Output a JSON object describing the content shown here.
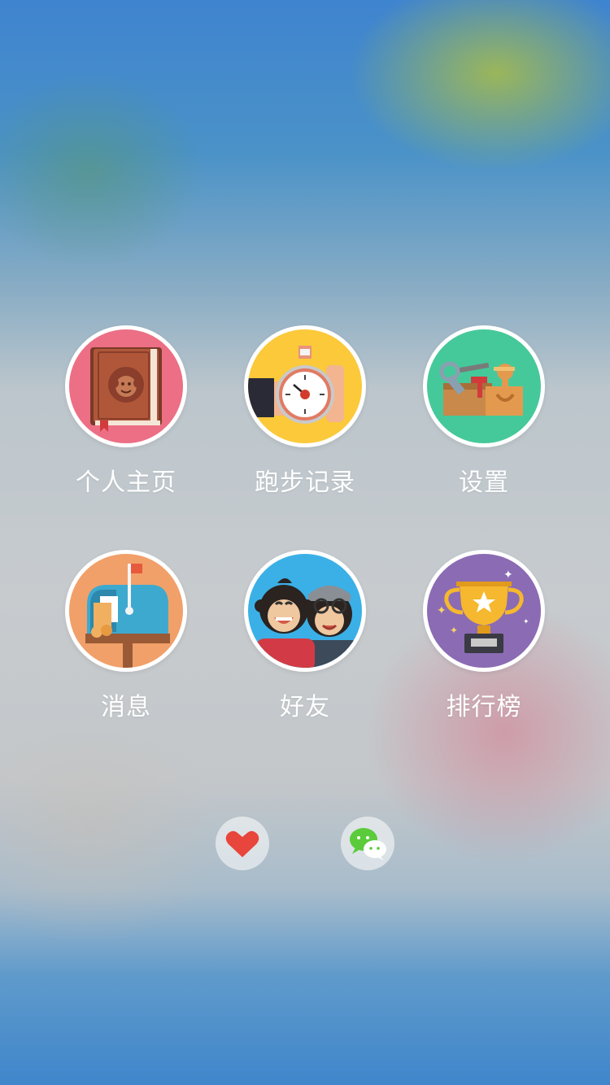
{
  "menu": {
    "items": [
      {
        "label": "个人主页",
        "icon": "profile-book-icon",
        "color": "#ec6f85"
      },
      {
        "label": "跑步记录",
        "icon": "stopwatch-icon",
        "color": "#fbc93a"
      },
      {
        "label": "设置",
        "icon": "toolbox-icon",
        "color": "#46c99a"
      },
      {
        "label": "消息",
        "icon": "mailbox-icon",
        "color": "#f1a06a"
      },
      {
        "label": "好友",
        "icon": "monkey-friends-icon",
        "color": "#3bb0e6"
      },
      {
        "label": "排行榜",
        "icon": "trophy-icon",
        "color": "#8b6bb3"
      }
    ]
  },
  "bottom": {
    "like_icon": "heart-icon",
    "share_icon": "wechat-icon"
  }
}
